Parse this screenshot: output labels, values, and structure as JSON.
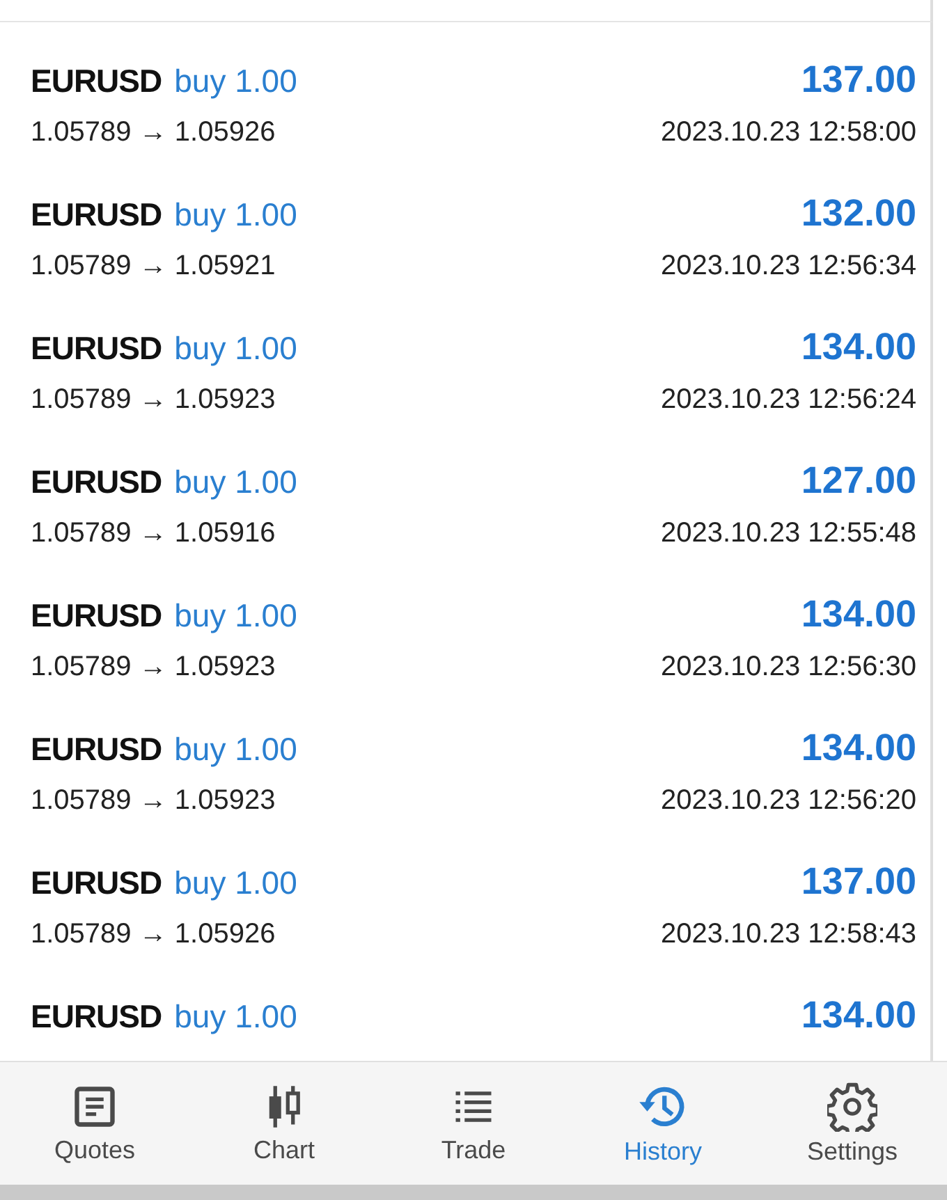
{
  "deals": [
    {
      "symbol": "EURUSD",
      "type": "buy",
      "volume": "1.00",
      "profit": "137.00",
      "prices": "1.05789 → 1.05926",
      "time": "2023.10.23 12:58:00"
    },
    {
      "symbol": "EURUSD",
      "type": "buy",
      "volume": "1.00",
      "profit": "132.00",
      "prices": "1.05789 → 1.05921",
      "time": "2023.10.23 12:56:34"
    },
    {
      "symbol": "EURUSD",
      "type": "buy",
      "volume": "1.00",
      "profit": "134.00",
      "prices": "1.05789 → 1.05923",
      "time": "2023.10.23 12:56:24"
    },
    {
      "symbol": "EURUSD",
      "type": "buy",
      "volume": "1.00",
      "profit": "127.00",
      "prices": "1.05789 → 1.05916",
      "time": "2023.10.23 12:55:48"
    },
    {
      "symbol": "EURUSD",
      "type": "buy",
      "volume": "1.00",
      "profit": "134.00",
      "prices": "1.05789 → 1.05923",
      "time": "2023.10.23 12:56:30"
    },
    {
      "symbol": "EURUSD",
      "type": "buy",
      "volume": "1.00",
      "profit": "134.00",
      "prices": "1.05789 → 1.05923",
      "time": "2023.10.23 12:56:20"
    },
    {
      "symbol": "EURUSD",
      "type": "buy",
      "volume": "1.00",
      "profit": "137.00",
      "prices": "1.05789 → 1.05926",
      "time": "2023.10.23 12:58:43"
    },
    {
      "symbol": "EURUSD",
      "type": "buy",
      "volume": "1.00",
      "profit": "134.00"
    }
  ],
  "nav": [
    {
      "kind": "quotes",
      "label": "Quotes",
      "selected": false
    },
    {
      "kind": "chart",
      "label": "Chart",
      "selected": false
    },
    {
      "kind": "trade",
      "label": "Trade",
      "selected": false
    },
    {
      "kind": "history",
      "label": "History",
      "selected": true
    },
    {
      "kind": "settings",
      "label": "Settings",
      "selected": false
    }
  ]
}
